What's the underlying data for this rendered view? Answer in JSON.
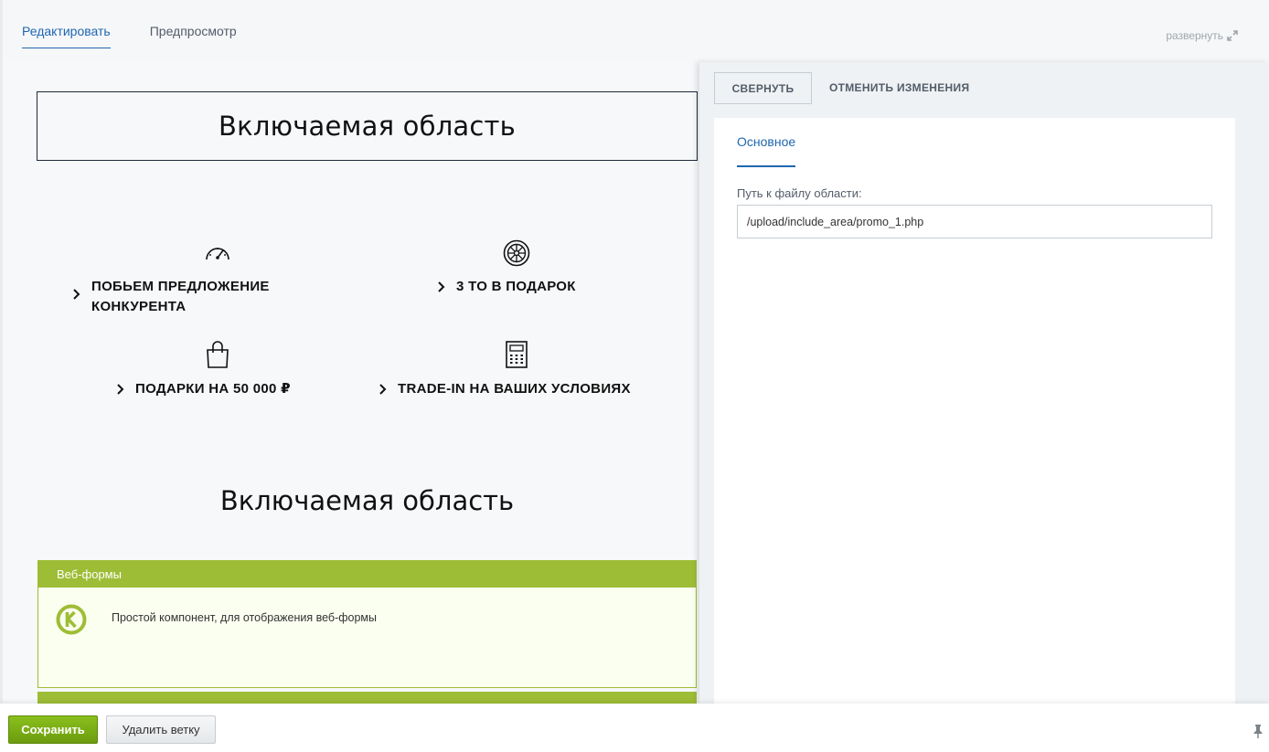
{
  "tabs": [
    {
      "label": "Редактировать",
      "active": true
    },
    {
      "label": "Предпросмотр",
      "active": false
    }
  ],
  "expand_label": "развернуть",
  "preview": {
    "include_area_title_1": "Включаемая область",
    "include_area_title_2": "Включаемая область",
    "features": [
      {
        "icon": "speedometer-icon",
        "line1": "ПОБЬЕМ ПРЕДЛОЖЕНИЕ",
        "line2": "КОНКУРЕНТА"
      },
      {
        "icon": "wheel-icon",
        "line1": "3 ТО В ПОДАРОК",
        "line2": ""
      },
      {
        "icon": "shopping-bag-icon",
        "line1": "ПОДАРКИ НА 50 000 ₽",
        "line2": ""
      },
      {
        "icon": "calculator-icon",
        "line1": "TRADE-IN НА ВАШИХ УСЛОВИЯХ",
        "line2": ""
      }
    ],
    "webforms": {
      "header": "Веб-формы",
      "description": "Простой компонент, для отображения веб-формы",
      "accent_color": "#9ebd36"
    }
  },
  "panel": {
    "collapse_button": "СВЕРНУТЬ",
    "cancel_button": "ОТМЕНИТЬ ИЗМЕНЕНИЯ",
    "tab_label": "Основное",
    "field_label": "Путь к файлу области:",
    "field_value": "/upload/include_area/promo_1.php"
  },
  "bottom": {
    "save_button": "Сохранить",
    "delete_button": "Удалить ветку"
  }
}
